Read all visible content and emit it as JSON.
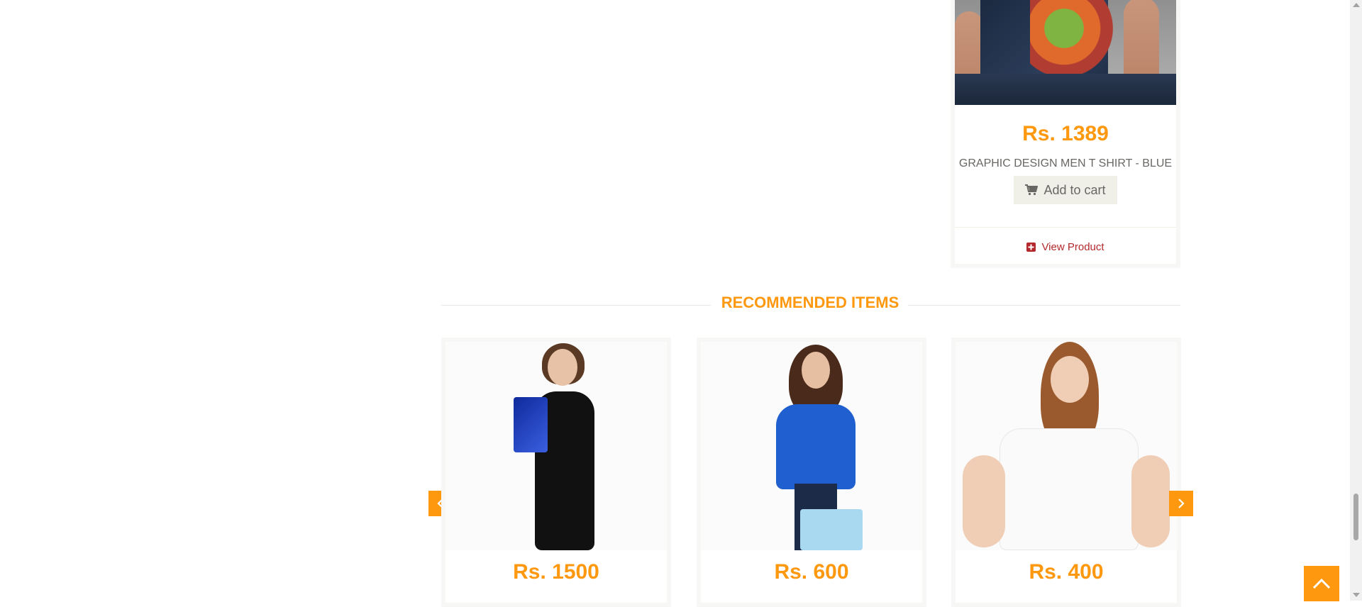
{
  "featured_product": {
    "price": "Rs. 1389",
    "name": "GRAPHIC DESIGN MEN T SHIRT - BLUE",
    "add_to_cart_label": "Add to cart",
    "view_product_label": "View Product",
    "cart_icon": "shopping-cart-icon",
    "view_icon": "plus-square-icon"
  },
  "recommended": {
    "title": "RECOMMENDED ITEMS",
    "items": [
      {
        "price": "Rs. 1500"
      },
      {
        "price": "Rs. 600"
      },
      {
        "price": "Rs. 400"
      }
    ],
    "prev_icon": "chevron-left-icon",
    "next_icon": "chevron-right-icon"
  },
  "scroll_top_icon": "chevron-up-icon",
  "colors": {
    "accent": "#fe980f",
    "link_red": "#b3282d",
    "text_gray": "#696763",
    "button_bg": "#f0f0e9"
  }
}
